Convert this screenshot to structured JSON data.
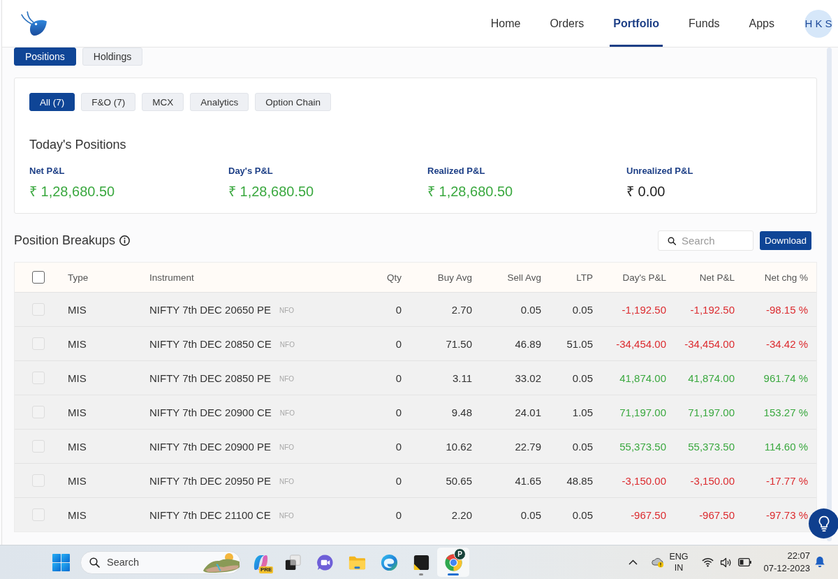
{
  "header": {
    "nav": [
      {
        "label": "Home",
        "selected": false
      },
      {
        "label": "Orders",
        "selected": false
      },
      {
        "label": "Portfolio",
        "selected": true
      },
      {
        "label": "Funds",
        "selected": false
      },
      {
        "label": "Apps",
        "selected": false
      }
    ],
    "avatar": "H K S"
  },
  "view_tabs": [
    {
      "label": "Positions",
      "selected": true
    },
    {
      "label": "Holdings",
      "selected": false
    }
  ],
  "summary": {
    "filters": [
      {
        "label": "All (7)",
        "selected": true
      },
      {
        "label": "F&O (7)",
        "selected": false
      },
      {
        "label": "MCX",
        "selected": false
      },
      {
        "label": "Analytics",
        "selected": false
      },
      {
        "label": "Option Chain",
        "selected": false
      }
    ],
    "title": "Today's Positions",
    "stats": [
      {
        "label": "Net P&L",
        "value": "₹ 1,28,680.50",
        "color": "#3aa83f"
      },
      {
        "label": "Day's P&L",
        "value": "₹ 1,28,680.50",
        "color": "#3aa83f"
      },
      {
        "label": "Realized P&L",
        "value": "₹ 1,28,680.50",
        "color": "#3aa83f"
      },
      {
        "label": "Unrealized P&L",
        "value": "₹ 0.00",
        "color": "#222222"
      }
    ]
  },
  "breakups": {
    "title": "Position Breakups",
    "search": {
      "placeholder": "Search"
    },
    "download": "Download"
  },
  "table": {
    "select_all": {
      "checked": false
    },
    "columns": [
      "Type",
      "Instrument",
      "Qty",
      "Buy Avg",
      "Sell Avg",
      "LTP",
      "Day's P&L",
      "Net P&L",
      "Net chg %"
    ],
    "rows": [
      {
        "checked": false,
        "disabled": true,
        "type": "MIS",
        "instrument": "NIFTY 7th DEC 20650 PE",
        "exchange": "NFO",
        "qty": "0",
        "buy_avg": "2.70",
        "sell_avg": "0.05",
        "ltp": "0.05",
        "days_pnl": "-1,192.50",
        "net_pnl": "-1,192.50",
        "net_chg": "-98.15 %",
        "color": "#dc2b2f"
      },
      {
        "checked": false,
        "disabled": true,
        "type": "MIS",
        "instrument": "NIFTY 7th DEC 20850 CE",
        "exchange": "NFO",
        "qty": "0",
        "buy_avg": "71.50",
        "sell_avg": "46.89",
        "ltp": "51.05",
        "days_pnl": "-34,454.00",
        "net_pnl": "-34,454.00",
        "net_chg": "-34.42 %",
        "color": "#dc2b2f"
      },
      {
        "checked": false,
        "disabled": true,
        "type": "MIS",
        "instrument": "NIFTY 7th DEC 20850 PE",
        "exchange": "NFO",
        "qty": "0",
        "buy_avg": "3.11",
        "sell_avg": "33.02",
        "ltp": "0.05",
        "days_pnl": "41,874.00",
        "net_pnl": "41,874.00",
        "net_chg": "961.74 %",
        "color": "#3aa83f"
      },
      {
        "checked": false,
        "disabled": true,
        "type": "MIS",
        "instrument": "NIFTY 7th DEC 20900 CE",
        "exchange": "NFO",
        "qty": "0",
        "buy_avg": "9.48",
        "sell_avg": "24.01",
        "ltp": "1.05",
        "days_pnl": "71,197.00",
        "net_pnl": "71,197.00",
        "net_chg": "153.27 %",
        "color": "#3aa83f"
      },
      {
        "checked": false,
        "disabled": true,
        "type": "MIS",
        "instrument": "NIFTY 7th DEC 20900 PE",
        "exchange": "NFO",
        "qty": "0",
        "buy_avg": "10.62",
        "sell_avg": "22.79",
        "ltp": "0.05",
        "days_pnl": "55,373.50",
        "net_pnl": "55,373.50",
        "net_chg": "114.60 %",
        "color": "#3aa83f"
      },
      {
        "checked": false,
        "disabled": true,
        "type": "MIS",
        "instrument": "NIFTY 7th DEC 20950 PE",
        "exchange": "NFO",
        "qty": "0",
        "buy_avg": "50.65",
        "sell_avg": "41.65",
        "ltp": "48.85",
        "days_pnl": "-3,150.00",
        "net_pnl": "-3,150.00",
        "net_chg": "-17.77 %",
        "color": "#dc2b2f"
      },
      {
        "checked": false,
        "disabled": true,
        "type": "MIS",
        "instrument": "NIFTY 7th DEC 21100 CE",
        "exchange": "NFO",
        "qty": "0",
        "buy_avg": "2.20",
        "sell_avg": "0.05",
        "ltp": "0.05",
        "days_pnl": "-967.50",
        "net_pnl": "-967.50",
        "net_chg": "-97.73 %",
        "color": "#dc2b2f"
      }
    ]
  },
  "taskbar": {
    "search": {
      "placeholder": "Search"
    },
    "apps": [
      {
        "kind": "copilot",
        "badge": "PRE",
        "running": false,
        "selected": false
      },
      {
        "kind": "task_view",
        "running": false,
        "selected": false
      },
      {
        "kind": "meet",
        "running": false,
        "selected": false
      },
      {
        "kind": "folder",
        "running": false,
        "selected": false
      },
      {
        "kind": "edge",
        "running": false,
        "selected": false
      },
      {
        "kind": "notes",
        "running": true,
        "selected": false
      },
      {
        "kind": "chrome",
        "badge": "P",
        "running": true,
        "selected": true
      }
    ],
    "tray": {
      "language": "ENG",
      "region": "IN",
      "time": "22:07",
      "date": "07-12-2023"
    }
  }
}
